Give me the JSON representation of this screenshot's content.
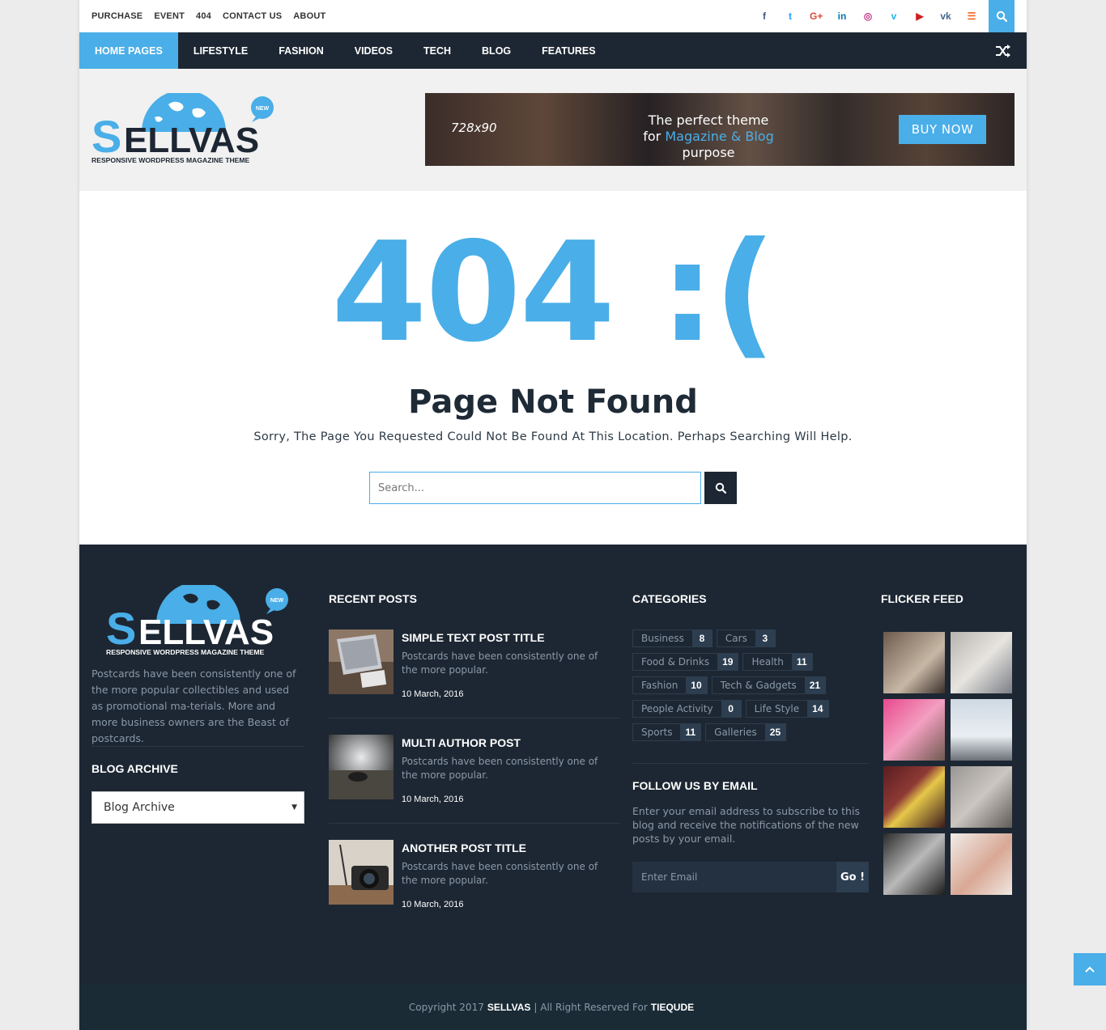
{
  "topbar": {
    "links": [
      "PURCHASE",
      "EVENT",
      "404",
      "CONTACT US",
      "ABOUT"
    ],
    "socials": [
      {
        "icon": "facebook-icon",
        "glyph": "f",
        "color": "#3b5998"
      },
      {
        "icon": "twitter-icon",
        "glyph": "t",
        "color": "#1da1f2"
      },
      {
        "icon": "google-plus-icon",
        "glyph": "G+",
        "color": "#dd4b39"
      },
      {
        "icon": "linkedin-icon",
        "glyph": "in",
        "color": "#0077b5"
      },
      {
        "icon": "instagram-icon",
        "glyph": "◎",
        "color": "#c13584"
      },
      {
        "icon": "vimeo-icon",
        "glyph": "v",
        "color": "#1ab7ea"
      },
      {
        "icon": "youtube-icon",
        "glyph": "▶",
        "color": "#cd201f"
      },
      {
        "icon": "vk-icon",
        "glyph": "vk",
        "color": "#45668e"
      },
      {
        "icon": "rss-icon",
        "glyph": "☰",
        "color": "#f26522"
      }
    ]
  },
  "nav": {
    "items": [
      "HOME PAGES",
      "LIFESTYLE",
      "FASHION",
      "VIDEOS",
      "TECH",
      "BLOG",
      "FEATURES"
    ],
    "active_index": 0
  },
  "logo": {
    "brand": "SELLVAS",
    "badge": "NEW",
    "tagline": "RESPONSIVE WORDPRESS MAGAZINE THEME"
  },
  "ad": {
    "size": "728x90",
    "line1": "The perfect theme",
    "line2_prefix": "for ",
    "line2_highlight": "Magazine & Blog",
    "line2_suffix": " purpose",
    "button": "BUY NOW"
  },
  "error": {
    "code": "404 :(",
    "title": "Page Not Found",
    "message": "Sorry, The Page You Requested Could Not Be Found At This Location. Perhaps Searching Will Help.",
    "search_placeholder": "Search..."
  },
  "footer": {
    "about": "Postcards have been consistently one of the more popular collectibles and used as promotional ma-terials. More and more business owners are the Beast of postcards.",
    "blog_archive_heading": "BLOG ARCHIVE",
    "blog_archive_value": "Blog Archive",
    "recent_posts_heading": "RECENT POSTS",
    "posts": [
      {
        "title": "SIMPLE TEXT POST TITLE",
        "excerpt": "Postcards have been consistently one of the more popular.",
        "date": "10 March, 2016"
      },
      {
        "title": "MULTI AUTHOR POST",
        "excerpt": "Postcards have been consistently one of the more popular.",
        "date": "10 March, 2016"
      },
      {
        "title": "ANOTHER POST TITLE",
        "excerpt": "Postcards have been consistently one of the more popular.",
        "date": "10 March, 2016"
      }
    ],
    "categories_heading": "CATEGORIES",
    "categories": [
      {
        "name": "Business",
        "count": "8"
      },
      {
        "name": "Cars",
        "count": "3"
      },
      {
        "name": "Food & Drinks",
        "count": "19"
      },
      {
        "name": "Health",
        "count": "11"
      },
      {
        "name": "Fashion",
        "count": "10"
      },
      {
        "name": "Tech & Gadgets",
        "count": "21"
      },
      {
        "name": "People Activity",
        "count": "0"
      },
      {
        "name": "Life Style",
        "count": "14"
      },
      {
        "name": "Sports",
        "count": "11"
      },
      {
        "name": "Galleries",
        "count": "25"
      }
    ],
    "follow_heading": "FOLLOW US BY EMAIL",
    "follow_text": "Enter your email address to subscribe to this blog and receive the notifications of the new posts by your email.",
    "email_placeholder": "Enter Email",
    "email_button": "Go !",
    "flickr_heading": "FLICKER FEED",
    "copyright_prefix": "Copyright 2017",
    "copyright_brand": "SELLVAS",
    "copyright_middle": "| All Right Reserved For",
    "copyright_owner": "TIEQUDE"
  },
  "colors": {
    "accent": "#4aaee8",
    "dark": "#1d2733"
  }
}
